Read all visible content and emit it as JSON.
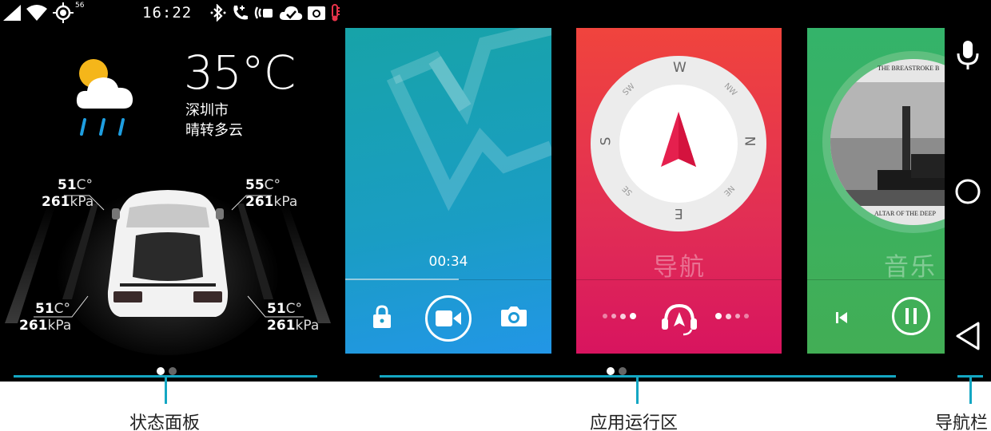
{
  "status_bar": {
    "signal_strength": "56",
    "time": "16:22",
    "icons_left": [
      "cellular-signal-icon",
      "wifi-icon",
      "gps-icon"
    ],
    "icons_right": [
      "bluetooth-icon",
      "phone-call-icon",
      "nfc-icon",
      "cloud-check-icon",
      "camera-icon",
      "thermometer-icon"
    ]
  },
  "weather": {
    "icon": "partly-cloudy-rain-icon",
    "temperature": "35°C",
    "city": "深圳市",
    "condition": "晴转多云"
  },
  "tires": {
    "front_left": {
      "temp": "51",
      "temp_unit": "C°",
      "pressure": "261",
      "pressure_unit": "kPa"
    },
    "front_right": {
      "temp": "55",
      "temp_unit": "C°",
      "pressure": "261",
      "pressure_unit": "kPa"
    },
    "rear_left": {
      "temp": "51",
      "temp_unit": "C°",
      "pressure": "261",
      "pressure_unit": "kPa"
    },
    "rear_right": {
      "temp": "51",
      "temp_unit": "C°",
      "pressure": "261",
      "pressure_unit": "kPa"
    }
  },
  "status_panel_pager": {
    "pages": 2,
    "active": 0
  },
  "app_area_pager": {
    "pages": 2,
    "active": 0
  },
  "cards": {
    "camera": {
      "recording_time": "00:34",
      "progress": 0.55,
      "controls": [
        "lock-icon",
        "video-record-icon",
        "camera-icon"
      ],
      "colors": {
        "top": "#17a3a8",
        "bottom": "#2296e6"
      }
    },
    "navigation": {
      "label": "导航",
      "compass": [
        "W",
        "NW",
        "N",
        "NE",
        "E",
        "SE",
        "S",
        "SW"
      ],
      "controls": [
        "navigate-headset-icon"
      ],
      "colors": {
        "top": "#f0443d",
        "bottom": "#d8145f"
      }
    },
    "music": {
      "label": "音乐",
      "album_text_top": "THE BREASTROKE B",
      "album_text_bottom": "ALTAR OF THE DEEP",
      "controls": [
        "previous-icon",
        "pause-icon"
      ],
      "colors": {
        "top": "#34b36a",
        "bottom": "#42ae55"
      }
    }
  },
  "nav_bar": {
    "buttons": [
      "microphone-icon",
      "home-circle-icon",
      "back-triangle-icon"
    ]
  },
  "annotations": {
    "status_panel": "状态面板",
    "app_area": "应用运行区",
    "nav_bar": "导航栏",
    "accent_color": "#14a7c3"
  }
}
